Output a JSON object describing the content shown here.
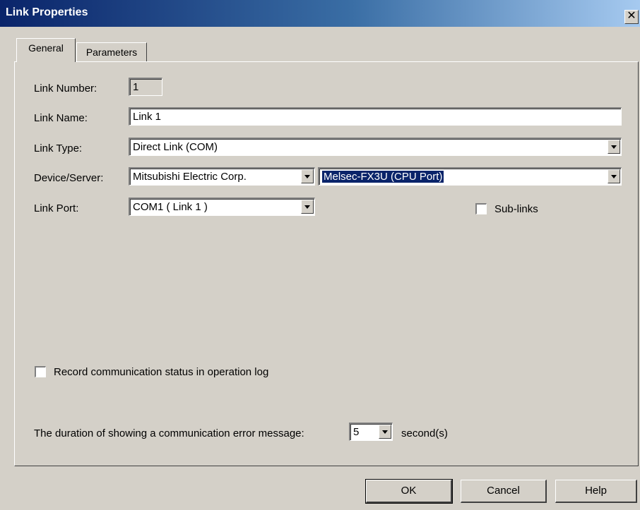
{
  "window": {
    "title": "Link Properties",
    "close_glyph": "✕"
  },
  "tabs": [
    {
      "label": "General",
      "active": true
    },
    {
      "label": "Parameters",
      "active": false
    }
  ],
  "general": {
    "link_number": {
      "label": "Link Number:",
      "value": "1"
    },
    "link_name": {
      "label": "Link Name:",
      "value": "Link 1"
    },
    "link_type": {
      "label": "Link Type:",
      "value": "Direct Link (COM)"
    },
    "device_server": {
      "label": "Device/Server:",
      "manufacturer": "Mitsubishi Electric Corp.",
      "model": "Melsec-FX3U (CPU Port)"
    },
    "link_port": {
      "label": "Link Port:",
      "value": "COM1 ( Link 1 )"
    },
    "sub_links": {
      "label": "Sub-links",
      "checked": false
    },
    "record_status": {
      "label": "Record communication status in operation log",
      "checked": false
    },
    "error_duration": {
      "label": "The duration of showing a communication error message:",
      "value": "5",
      "unit": "second(s)"
    }
  },
  "buttons": {
    "ok": "OK",
    "cancel": "Cancel",
    "help": "Help"
  }
}
